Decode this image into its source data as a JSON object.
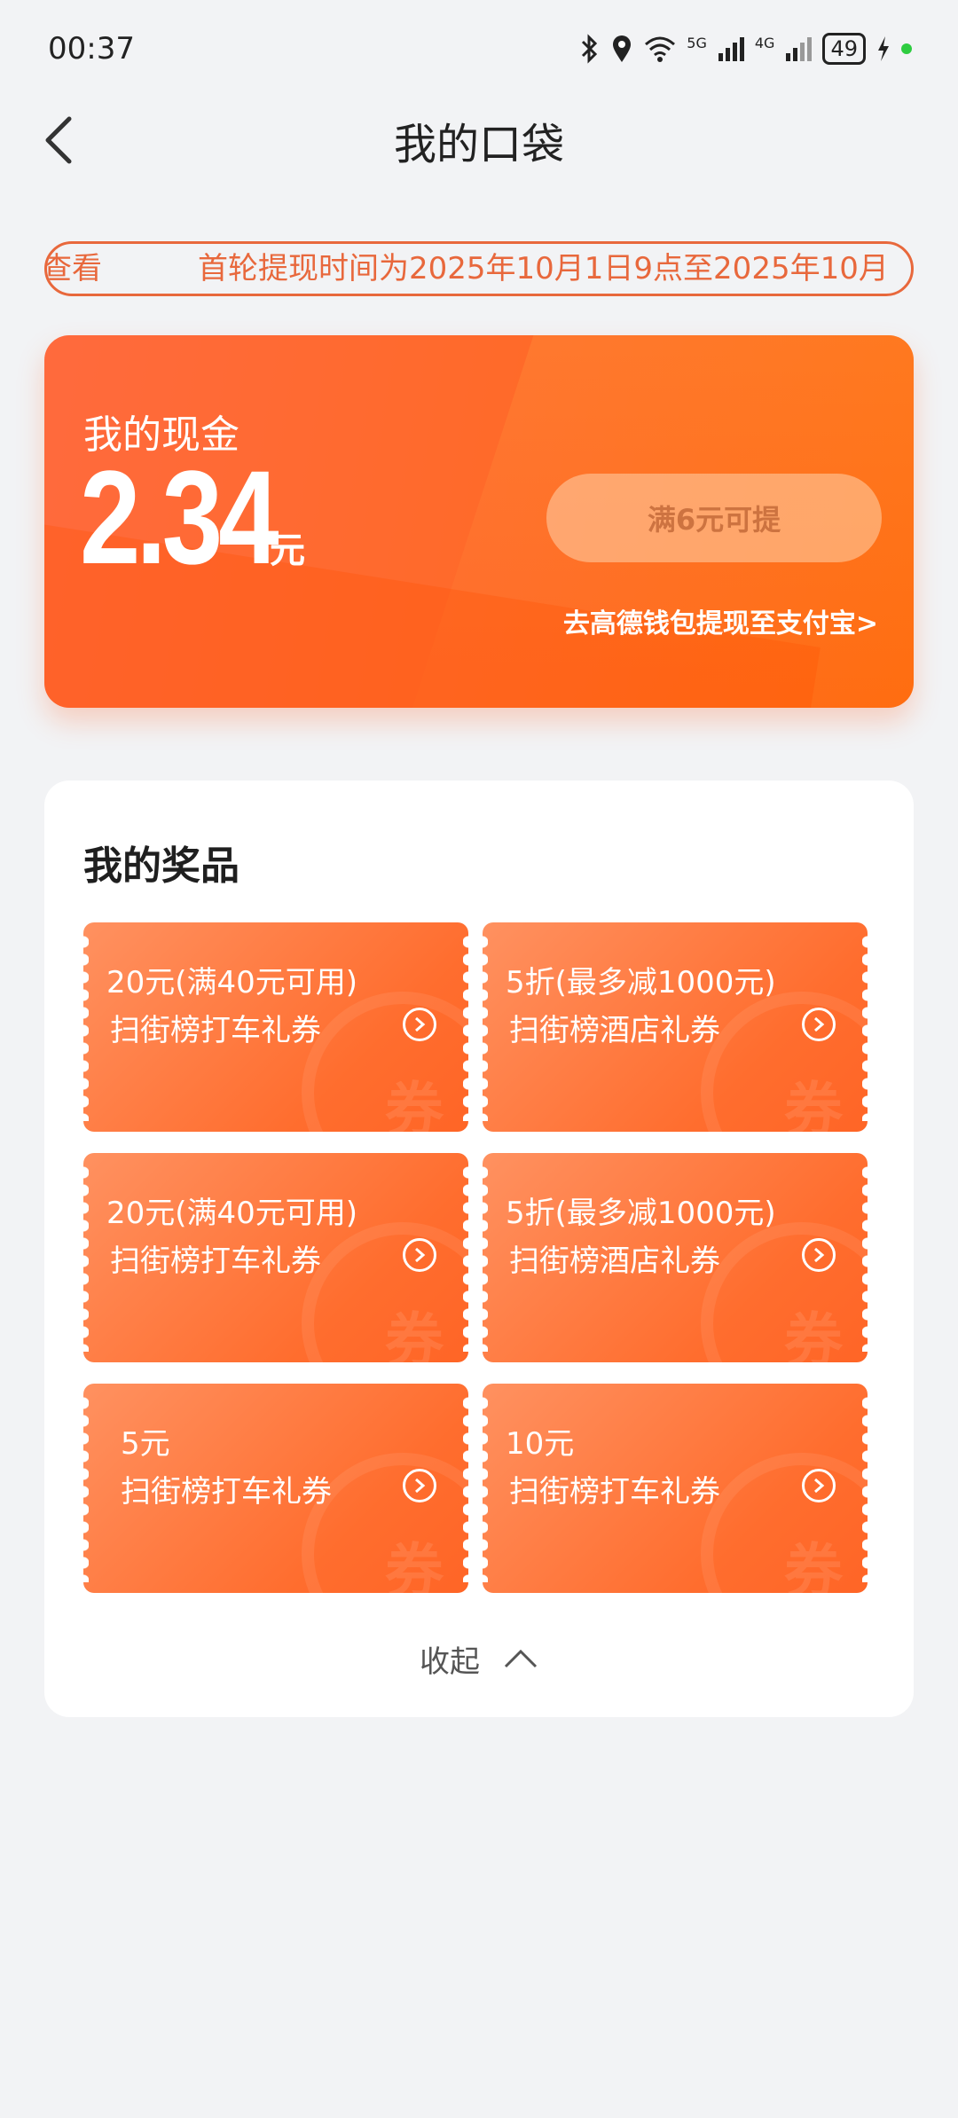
{
  "status_bar": {
    "time": "00:37",
    "battery": "49",
    "net1": "5G",
    "net2": "4G"
  },
  "header": {
    "title": "我的口袋"
  },
  "notice": {
    "fragment": "查看",
    "message": "首轮提现时间为2025年10月1日9点至2025年10月"
  },
  "cash": {
    "label": "我的现金",
    "amount": "2.34",
    "unit": "元",
    "withdraw_button": "满6元可提",
    "wallet_link": "去高德钱包提现至支付宝>"
  },
  "prizes": {
    "title": "我的奖品",
    "stamp_char": "券",
    "coupons": [
      {
        "value": "20元(满40元可用)",
        "name": "扫街榜打车礼券"
      },
      {
        "value": "5折(最多减1000元)",
        "name": "扫街榜酒店礼券"
      },
      {
        "value": "20元(满40元可用)",
        "name": "扫街榜打车礼券"
      },
      {
        "value": "5折(最多减1000元)",
        "name": "扫街榜酒店礼券"
      },
      {
        "value": "5元",
        "name": "扫街榜打车礼券"
      },
      {
        "value": "10元",
        "name": "扫街榜打车礼券"
      }
    ],
    "collapse_label": "收起"
  },
  "colors": {
    "accent": "#ff6a2a",
    "notice": "#e8683c",
    "background": "#f2f3f5"
  }
}
